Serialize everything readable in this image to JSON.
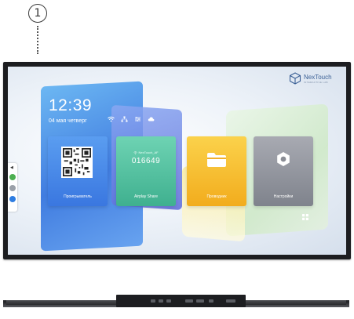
{
  "callout": {
    "number": "1"
  },
  "screen": {
    "time": "12:39",
    "date": "04 мая четверг",
    "tiles": [
      {
        "label": "Проигрыватель",
        "icon": "qr-code-icon"
      },
      {
        "label": "Airplay Share",
        "icon": "wifi-icon",
        "code_label": "NexTouch_AF",
        "code": "016649"
      },
      {
        "label": "Проводник",
        "icon": "folder-icon"
      },
      {
        "label": "Настройки",
        "icon": "gear-icon"
      }
    ],
    "logo": {
      "name": "NexTouch",
      "tagline": "INTERACTIVE LAB"
    }
  },
  "colors": {
    "bezel": "#1c1d20",
    "tile_player": "#3a77e0",
    "tile_airplay": "#3fb08f",
    "tile_files": "#f2ac1d",
    "tile_settings": "#7f838c",
    "side_green": "#4caf50",
    "side_blue": "#2f7de1"
  }
}
